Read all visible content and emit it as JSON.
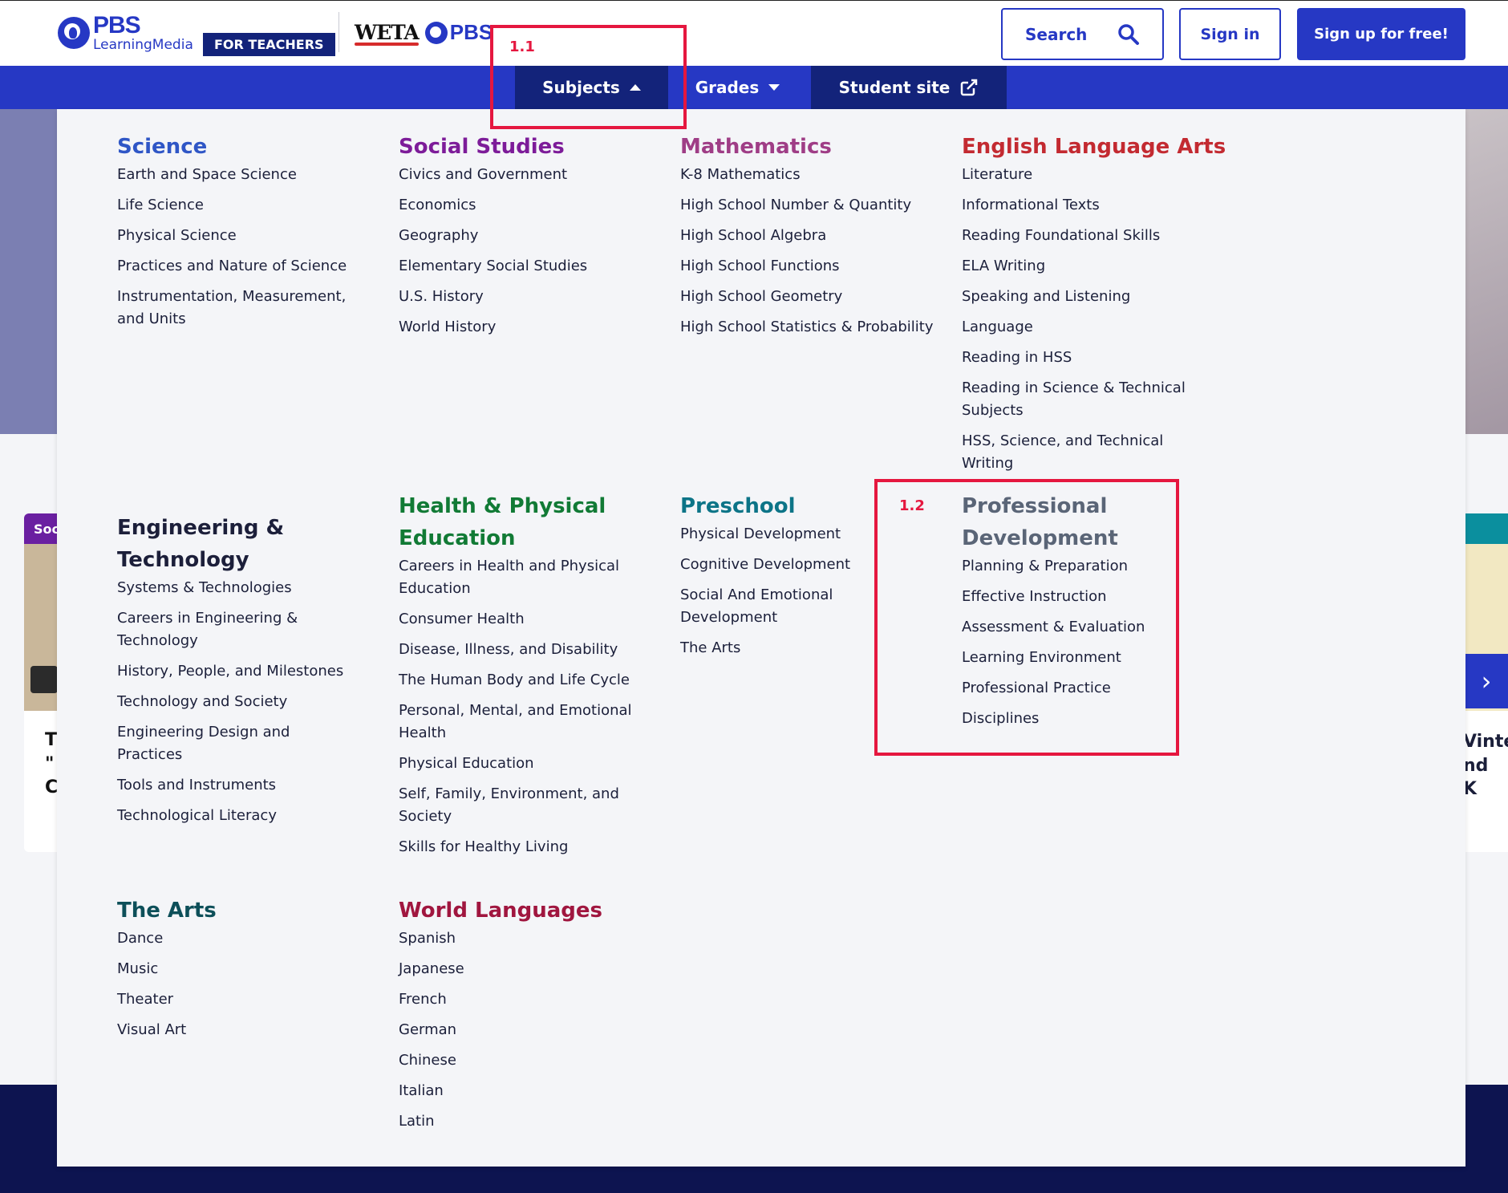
{
  "header": {
    "logo_pbs": "PBS",
    "logo_sub": "LearningMedia",
    "audience_badge": "FOR TEACHERS",
    "partner_name": "WETA",
    "partner_pbs": "PBS",
    "search_label": "Search",
    "signin_label": "Sign in",
    "signup_label": "Sign up for free!"
  },
  "nav": {
    "subjects": "Subjects",
    "grades": "Grades",
    "student_site": "Student site"
  },
  "annotations": {
    "box1": "1.1",
    "box2": "1.2"
  },
  "background": {
    "left_card_tag": "Soc",
    "left_card_title": "T\n\"\nC",
    "right_card_title": "Vinte\nnd K"
  },
  "menu": {
    "science": {
      "title": "Science",
      "items": [
        "Earth and Space Science",
        "Life Science",
        "Physical Science",
        "Practices and Nature of Science",
        "Instrumentation, Measurement, and Units"
      ]
    },
    "social_studies": {
      "title": "Social Studies",
      "items": [
        "Civics and Government",
        "Economics",
        "Geography",
        "Elementary Social Studies",
        "U.S. History",
        "World History"
      ]
    },
    "mathematics": {
      "title": "Mathematics",
      "items": [
        "K-8 Mathematics",
        "High School Number & Quantity",
        "High School Algebra",
        "High School Functions",
        "High School Geometry",
        "High School Statistics & Probability"
      ]
    },
    "ela": {
      "title": "English Language Arts",
      "items": [
        "Literature",
        "Informational Texts",
        "Reading Foundational Skills",
        "ELA Writing",
        "Speaking and Listening",
        "Language",
        "Reading in HSS",
        "Reading in Science & Technical Subjects",
        "HSS, Science, and Technical Writing"
      ]
    },
    "engineering": {
      "title": "Engineering & Technology",
      "items": [
        "Systems & Technologies",
        "Careers in Engineering & Technology",
        "History, People, and Milestones",
        "Technology and Society",
        "Engineering Design and Practices",
        "Tools and Instruments",
        "Technological Literacy"
      ]
    },
    "health": {
      "title": "Health & Physical Education",
      "items": [
        "Careers in Health and Physical Education",
        "Consumer Health",
        "Disease, Illness, and Disability",
        "The Human Body and Life Cycle",
        "Personal, Mental, and Emotional Health",
        "Physical Education",
        "Self, Family, Environment, and Society",
        "Skills for Healthy Living"
      ]
    },
    "preschool": {
      "title": "Preschool",
      "items": [
        "Physical Development",
        "Cognitive Development",
        "Social And Emotional Development",
        "The Arts"
      ]
    },
    "professional": {
      "title": "Professional Development",
      "items": [
        "Planning & Preparation",
        "Effective Instruction",
        "Assessment & Evaluation",
        "Learning Environment",
        "Professional Practice",
        "Disciplines"
      ]
    },
    "arts": {
      "title": "The Arts",
      "items": [
        "Dance",
        "Music",
        "Theater",
        "Visual Art"
      ]
    },
    "languages": {
      "title": "World Languages",
      "items": [
        "Spanish",
        "Japanese",
        "French",
        "German",
        "Chinese",
        "Italian",
        "Latin"
      ]
    }
  },
  "colors": {
    "brand_blue": "#2638c4",
    "nav_active": "#13237a",
    "highlight_red": "#e5173f"
  }
}
